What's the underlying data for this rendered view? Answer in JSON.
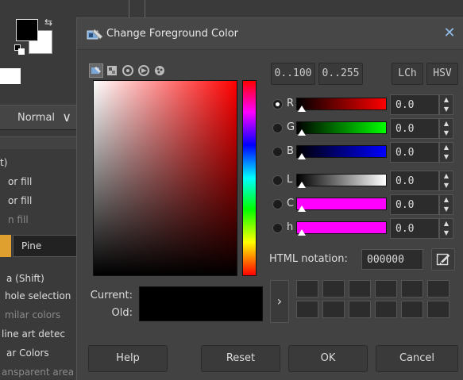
{
  "background": {
    "mode_dropdown": "Normal",
    "options": [
      {
        "text": "t)",
        "dim": false
      },
      {
        "text": "or fill",
        "dim": false
      },
      {
        "text": "or fill",
        "dim": false
      },
      {
        "text": "n fill",
        "dim": true
      }
    ],
    "pattern_name": "Pine",
    "lower_options": [
      {
        "text": "a  (Shift)",
        "dim": false
      },
      {
        "text": "hole selection",
        "dim": false
      },
      {
        "text": "milar colors",
        "dim": true
      },
      {
        "text": " line art detec",
        "dim": false
      },
      {
        "text": "ar Colors",
        "dim": false
      },
      {
        "text": "ansparent area",
        "dim": true
      }
    ]
  },
  "dialog": {
    "title": "Change Foreground Color",
    "close_glyph": "✕",
    "range_buttons": [
      "0..100",
      "0..255"
    ],
    "model_buttons": [
      "LCh",
      "HSV"
    ],
    "channels": [
      {
        "label": "R",
        "value": "0.0",
        "checked": true,
        "gradient": "linear-gradient(to right, #000, #f00)"
      },
      {
        "label": "G",
        "value": "0.0",
        "checked": false,
        "gradient": "linear-gradient(to right, #000, #0f0)"
      },
      {
        "label": "B",
        "value": "0.0",
        "checked": false,
        "gradient": "linear-gradient(to right, #000, #00f)"
      },
      {
        "label": "L",
        "value": "0.0",
        "checked": false,
        "gradient": "linear-gradient(to right, #000, #fff)"
      },
      {
        "label": "C",
        "value": "0.0",
        "checked": false,
        "gradient": "linear-gradient(to right, #f0f, #f0f)"
      },
      {
        "label": "h",
        "value": "0.0",
        "checked": false,
        "gradient": "linear-gradient(to right, #f0f, #f0f)"
      }
    ],
    "html_notation_label": "HTML notation:",
    "html_notation_value": "000000",
    "current_label": "Current:",
    "old_label": "Old:",
    "history_arrow": "›",
    "buttons": {
      "help": "Help",
      "reset": "Reset",
      "ok": "OK",
      "cancel": "Cancel"
    }
  }
}
